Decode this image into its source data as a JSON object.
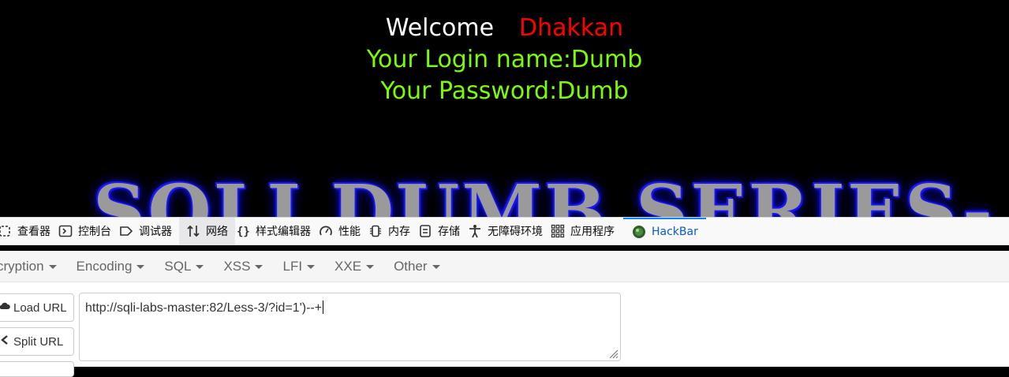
{
  "page": {
    "welcome_word": "Welcome",
    "welcome_name": "Dhakkan",
    "login_line": "Your Login name:Dumb",
    "password_line": "Your Password:Dumb",
    "banner_text": "SQLI DUMB SERIES-"
  },
  "devtools": {
    "tabs": [
      {
        "label": "查看器",
        "icon": "inspector-icon"
      },
      {
        "label": "控制台",
        "icon": "console-icon"
      },
      {
        "label": "调试器",
        "icon": "debugger-icon"
      },
      {
        "label": "网络",
        "icon": "network-icon",
        "active": true
      },
      {
        "label": "样式编辑器",
        "icon": "style-editor-icon"
      },
      {
        "label": "性能",
        "icon": "performance-icon"
      },
      {
        "label": "内存",
        "icon": "memory-icon"
      },
      {
        "label": "存储",
        "icon": "storage-icon"
      },
      {
        "label": "无障碍环境",
        "icon": "accessibility-icon"
      },
      {
        "label": "应用程序",
        "icon": "application-icon"
      },
      {
        "label": "HackBar",
        "icon": "hackbar-icon",
        "selected": true
      }
    ]
  },
  "hackbar": {
    "menu": [
      "cryption",
      "Encoding",
      "SQL",
      "XSS",
      "LFI",
      "XXE",
      "Other"
    ],
    "load_url_label": "Load URL",
    "split_url_label": "Split URL",
    "url_value": "http://sqli-labs-master:82/Less-3/?id=1')--+"
  },
  "colors": {
    "welcome": "#ffffff",
    "name": "#ff0000",
    "info": "#7cfc00",
    "hackbar_accent": "#0a84ff"
  }
}
